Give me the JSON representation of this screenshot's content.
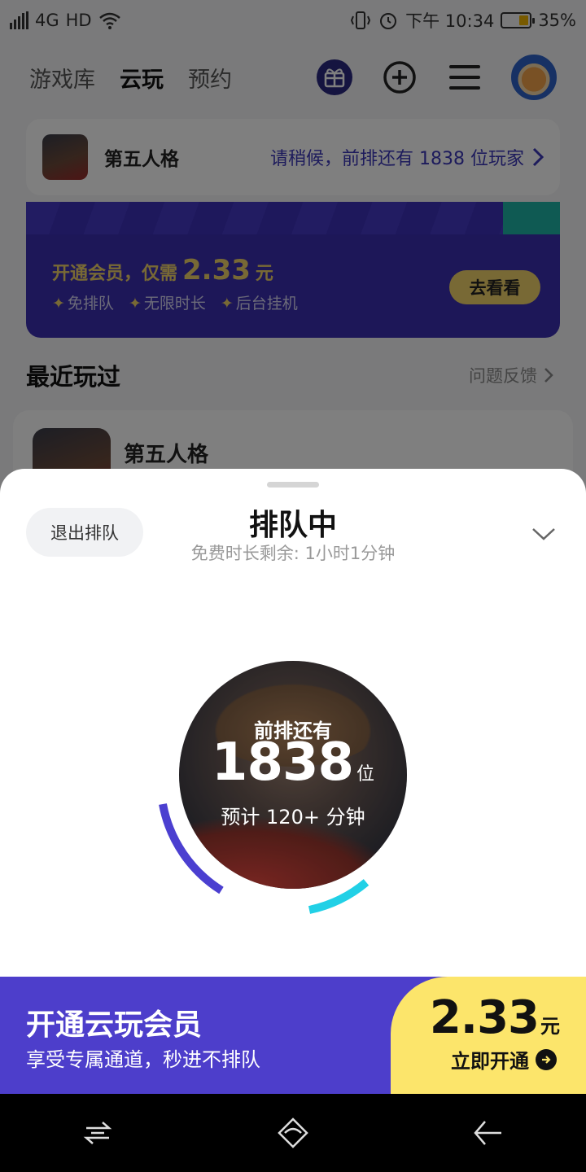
{
  "status_bar": {
    "network": "4G",
    "hd": "HD",
    "time": "下午 10:34",
    "battery": "35%",
    "battery_level": 0.35
  },
  "topnav": {
    "tabs": [
      {
        "label": "游戏库",
        "active": false
      },
      {
        "label": "云玩",
        "active": true
      },
      {
        "label": "预约",
        "active": false
      }
    ],
    "icons": [
      "gift-icon",
      "add-circle-icon",
      "menu-icon",
      "avatar"
    ]
  },
  "queue_card": {
    "game": "第五人格",
    "status": "请稍候，前排还有 1838 位玩家"
  },
  "vip_banner": {
    "prefix": "开通会员，仅需",
    "price": "2.33",
    "unit": "元",
    "features": [
      "免排队",
      "无限时长",
      "后台挂机"
    ],
    "button": "去看看"
  },
  "recent": {
    "title": "最近玩过",
    "feedback": "问题反馈",
    "items": [
      {
        "name": "第五人格"
      }
    ]
  },
  "sheet": {
    "exit_button": "退出排队",
    "title": "排队中",
    "subtitle": "免费时长剩余: 1小时1分钟",
    "circle": {
      "label": "前排还有",
      "count": "1838",
      "unit": "位",
      "eta": "预计 120+ 分钟"
    }
  },
  "promo": {
    "title": "开通云玩会员",
    "subtitle": "享受专属通道，秒进不排队",
    "price": "2.33",
    "unit": "元",
    "cta": "立即开通"
  },
  "colors": {
    "accent_purple": "#4d3ecb",
    "accent_teal": "#1fc6b7",
    "accent_yellow": "#fce56b"
  }
}
